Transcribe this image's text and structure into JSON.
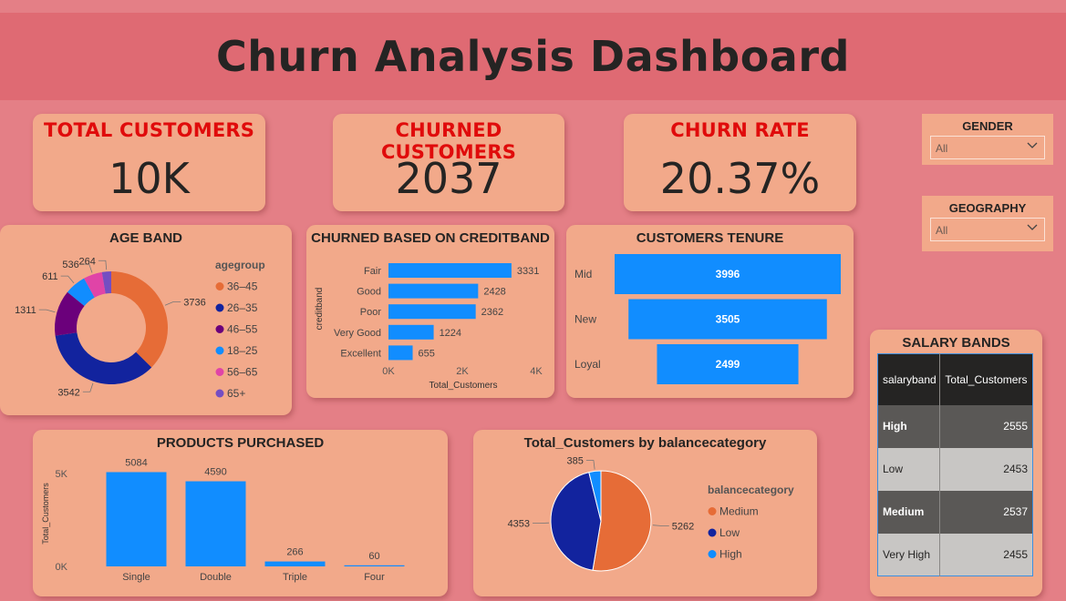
{
  "title": "Churn Analysis Dashboard",
  "kpis": {
    "total": {
      "label": "TOTAL CUSTOMERS",
      "value": "10K"
    },
    "churned": {
      "label": "CHURNED CUSTOMERS",
      "value": "2037"
    },
    "rate": {
      "label": "CHURN RATE",
      "value": "20.37%"
    }
  },
  "slicers": {
    "gender": {
      "label": "GENDER",
      "value": "All"
    },
    "geography": {
      "label": "GEOGRAPHY",
      "value": "All"
    }
  },
  "salary_table": {
    "title": "SALARY BANDS",
    "headers": [
      "salaryband",
      "Total_Customers"
    ],
    "rows": [
      [
        "High",
        "2555"
      ],
      [
        "Low",
        "2453"
      ],
      [
        "Medium",
        "2537"
      ],
      [
        "Very High",
        "2455"
      ]
    ]
  },
  "colors": {
    "orange": "#e66c37",
    "navy": "#12239e",
    "purple": "#6b007b",
    "blue": "#118dff",
    "pink": "#e044a7",
    "violet": "#744ec2",
    "card": "#f2a98a",
    "background": "#e47f86",
    "kpi_red": "#e00b0b"
  },
  "chart_data": [
    {
      "id": "age",
      "type": "pie",
      "donut": true,
      "title": "AGE BAND",
      "legend_title": "agegroup",
      "legend_position": "right",
      "categories": [
        "36–45",
        "26–35",
        "46–55",
        "18–25",
        "56–65",
        "65+"
      ],
      "values": [
        3736,
        3542,
        1311,
        611,
        536,
        264
      ],
      "colors": [
        "#e66c37",
        "#12239e",
        "#6b007b",
        "#118dff",
        "#e044a7",
        "#744ec2"
      ]
    },
    {
      "id": "credit",
      "type": "bar",
      "orientation": "horizontal",
      "title": "CHURNED BASED ON CREDITBAND",
      "xlabel": "Total_Customers",
      "ylabel": "creditband",
      "categories": [
        "Fair",
        "Good",
        "Poor",
        "Very Good",
        "Excellent"
      ],
      "values": [
        3331,
        2428,
        2362,
        1224,
        655
      ],
      "xlim": [
        0,
        4000
      ],
      "xticks": [
        "0K",
        "2K",
        "4K"
      ],
      "grid": false
    },
    {
      "id": "tenure",
      "type": "funnel",
      "title": "CUSTOMERS TENURE",
      "categories": [
        "Mid",
        "New",
        "Loyal"
      ],
      "values": [
        3996,
        3505,
        2499
      ]
    },
    {
      "id": "products",
      "type": "bar",
      "orientation": "vertical",
      "title": "PRODUCTS PURCHASED",
      "ylabel": "Total_Customers",
      "categories": [
        "Single",
        "Double",
        "Triple",
        "Four"
      ],
      "values": [
        5084,
        4590,
        266,
        60
      ],
      "ylim": [
        0,
        5500
      ],
      "yticks": [
        "0K",
        "5K"
      ],
      "grid": false
    },
    {
      "id": "balance",
      "type": "pie",
      "title": "Total_Customers by balancecategory",
      "legend_title": "balancecategory",
      "legend_position": "right",
      "categories": [
        "Medium",
        "Low",
        "High"
      ],
      "values": [
        5262,
        4353,
        385
      ],
      "colors": [
        "#e66c37",
        "#12239e",
        "#118dff"
      ]
    }
  ]
}
